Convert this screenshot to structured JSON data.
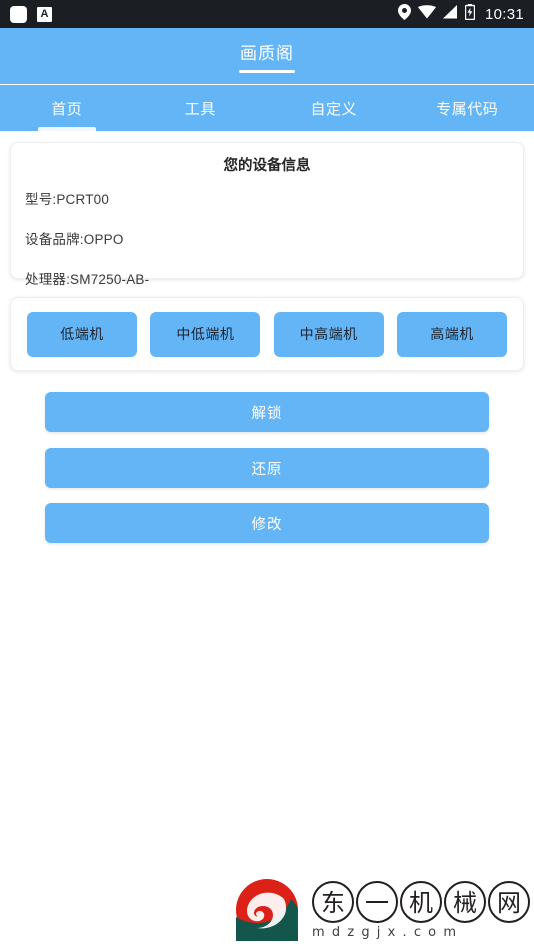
{
  "statusbar": {
    "left_icons": [
      {
        "name": "app-square-icon",
        "label": ""
      },
      {
        "name": "letter-a-icon",
        "label": "A"
      }
    ],
    "right_icons": [
      "location-pin-icon",
      "wifi-icon",
      "signal-bars-icon",
      "battery-charging-icon"
    ],
    "time": "10:31"
  },
  "header": {
    "title": "画质阁"
  },
  "tabs": [
    {
      "label": "首页",
      "active": true
    },
    {
      "label": "工具",
      "active": false
    },
    {
      "label": "自定义",
      "active": false
    },
    {
      "label": "专属代码",
      "active": false
    }
  ],
  "device_card": {
    "title": "您的设备信息",
    "lines": [
      "型号:PCRT00",
      "设备品牌:OPPO",
      "处理器:SM7250-AB-"
    ]
  },
  "tier_buttons": [
    {
      "label": "低端机"
    },
    {
      "label": "中低端机"
    },
    {
      "label": "中高端机"
    },
    {
      "label": "高端机"
    }
  ],
  "action_buttons": [
    {
      "label": "解锁"
    },
    {
      "label": "还原"
    },
    {
      "label": "修改"
    }
  ],
  "watermark": {
    "characters": [
      "东",
      "一",
      "机",
      "械",
      "网"
    ],
    "url": "mdzgjx.com",
    "url_spaced": "mdzgjx.com"
  },
  "colors": {
    "primary_blue": "#64b5f6",
    "statusbar_bg": "#1b1f24",
    "page_bg": "#ffffff",
    "tier_text": "#1c2430",
    "action_text": "#ffffff",
    "logo_red": "#dc2218",
    "logo_green": "#13564b"
  }
}
